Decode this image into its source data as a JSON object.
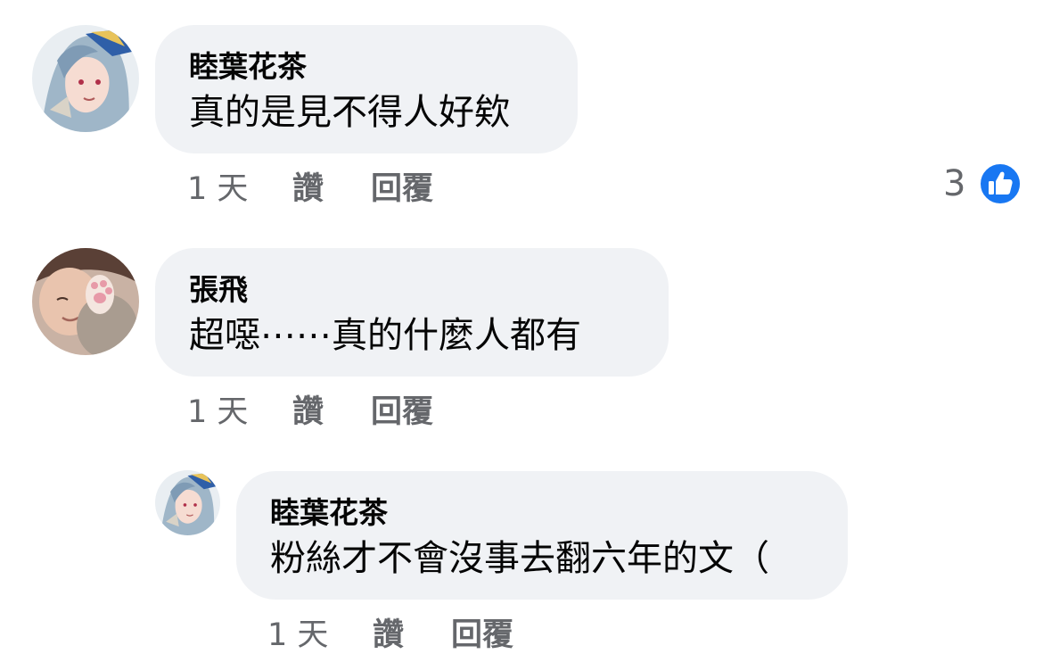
{
  "comments": [
    {
      "author": "睦葉花茶",
      "text": "真的是見不得人好欸",
      "time": "1 天",
      "like_label": "讚",
      "reply_label": "回覆",
      "reaction_count": "3"
    },
    {
      "author": "張飛",
      "text": "超噁⋯⋯真的什麼人都有",
      "time": "1 天",
      "like_label": "讚",
      "reply_label": "回覆"
    },
    {
      "author": "睦葉花茶",
      "text": "粉絲才不會沒事去翻六年的文（",
      "time": "1 天",
      "like_label": "讚",
      "reply_label": "回覆"
    }
  ],
  "colors": {
    "bubble": "#f0f2f5",
    "meta_text": "#65676b",
    "like_blue": "#1877f2"
  },
  "icons": {
    "reaction": "like-icon"
  }
}
